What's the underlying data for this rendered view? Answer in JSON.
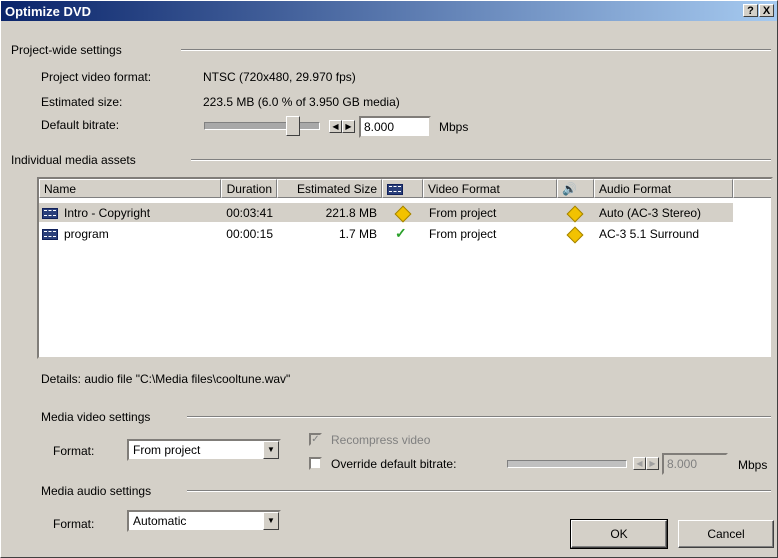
{
  "window": {
    "title": "Optimize DVD",
    "help_btn": "?",
    "close_btn": "X"
  },
  "project": {
    "section_label": "Project-wide settings",
    "video_format_label": "Project video format:",
    "video_format_value": "NTSC (720x480, 29.970 fps)",
    "estimated_size_label": "Estimated size:",
    "estimated_size_value": "223.5 MB   (6.0 % of 3.950 GB media)",
    "default_bitrate_label": "Default bitrate:",
    "bitrate_value": "8.000",
    "bitrate_unit": "Mbps",
    "bitrate_slider_level": 0.8
  },
  "assets": {
    "section_label": "Individual media assets",
    "columns": [
      "Name",
      "Duration",
      "Estimated Size",
      "",
      "Video Format",
      "",
      "Audio Format"
    ],
    "video_col_icon": "film-icon",
    "audio_col_icon": "audio-icon",
    "rows": [
      {
        "icon": "film-icon",
        "name": "Intro - Copyright",
        "duration": "00:03:41",
        "size": "221.8 MB",
        "video_status": "warning-icon",
        "video_format": "From project",
        "audio_status": "warning-icon",
        "audio_format": "Auto (AC-3 Stereo)",
        "selected": true
      },
      {
        "icon": "film-icon",
        "name": "program",
        "duration": "00:00:15",
        "size": "1.7 MB",
        "video_status": "check-icon",
        "video_format": "From project",
        "audio_status": "warning-icon",
        "audio_format": "AC-3 5.1 Surround",
        "selected": false
      }
    ],
    "details": "Details:  audio file \"C:\\Media files\\cooltune.wav\""
  },
  "media_video": {
    "section_label": "Media video settings",
    "format_label": "Format:",
    "format_value": "From project",
    "recompress_label": "Recompress video",
    "recompress_checked": true,
    "override_label": "Override default bitrate:",
    "override_checked": false,
    "bitrate_value": "8.000",
    "bitrate_unit": "Mbps",
    "bitrate_slider_level": 0.8
  },
  "media_audio": {
    "section_label": "Media audio settings",
    "format_label": "Format:",
    "format_value": "Automatic"
  },
  "buttons": {
    "ok": "OK",
    "cancel": "Cancel"
  }
}
